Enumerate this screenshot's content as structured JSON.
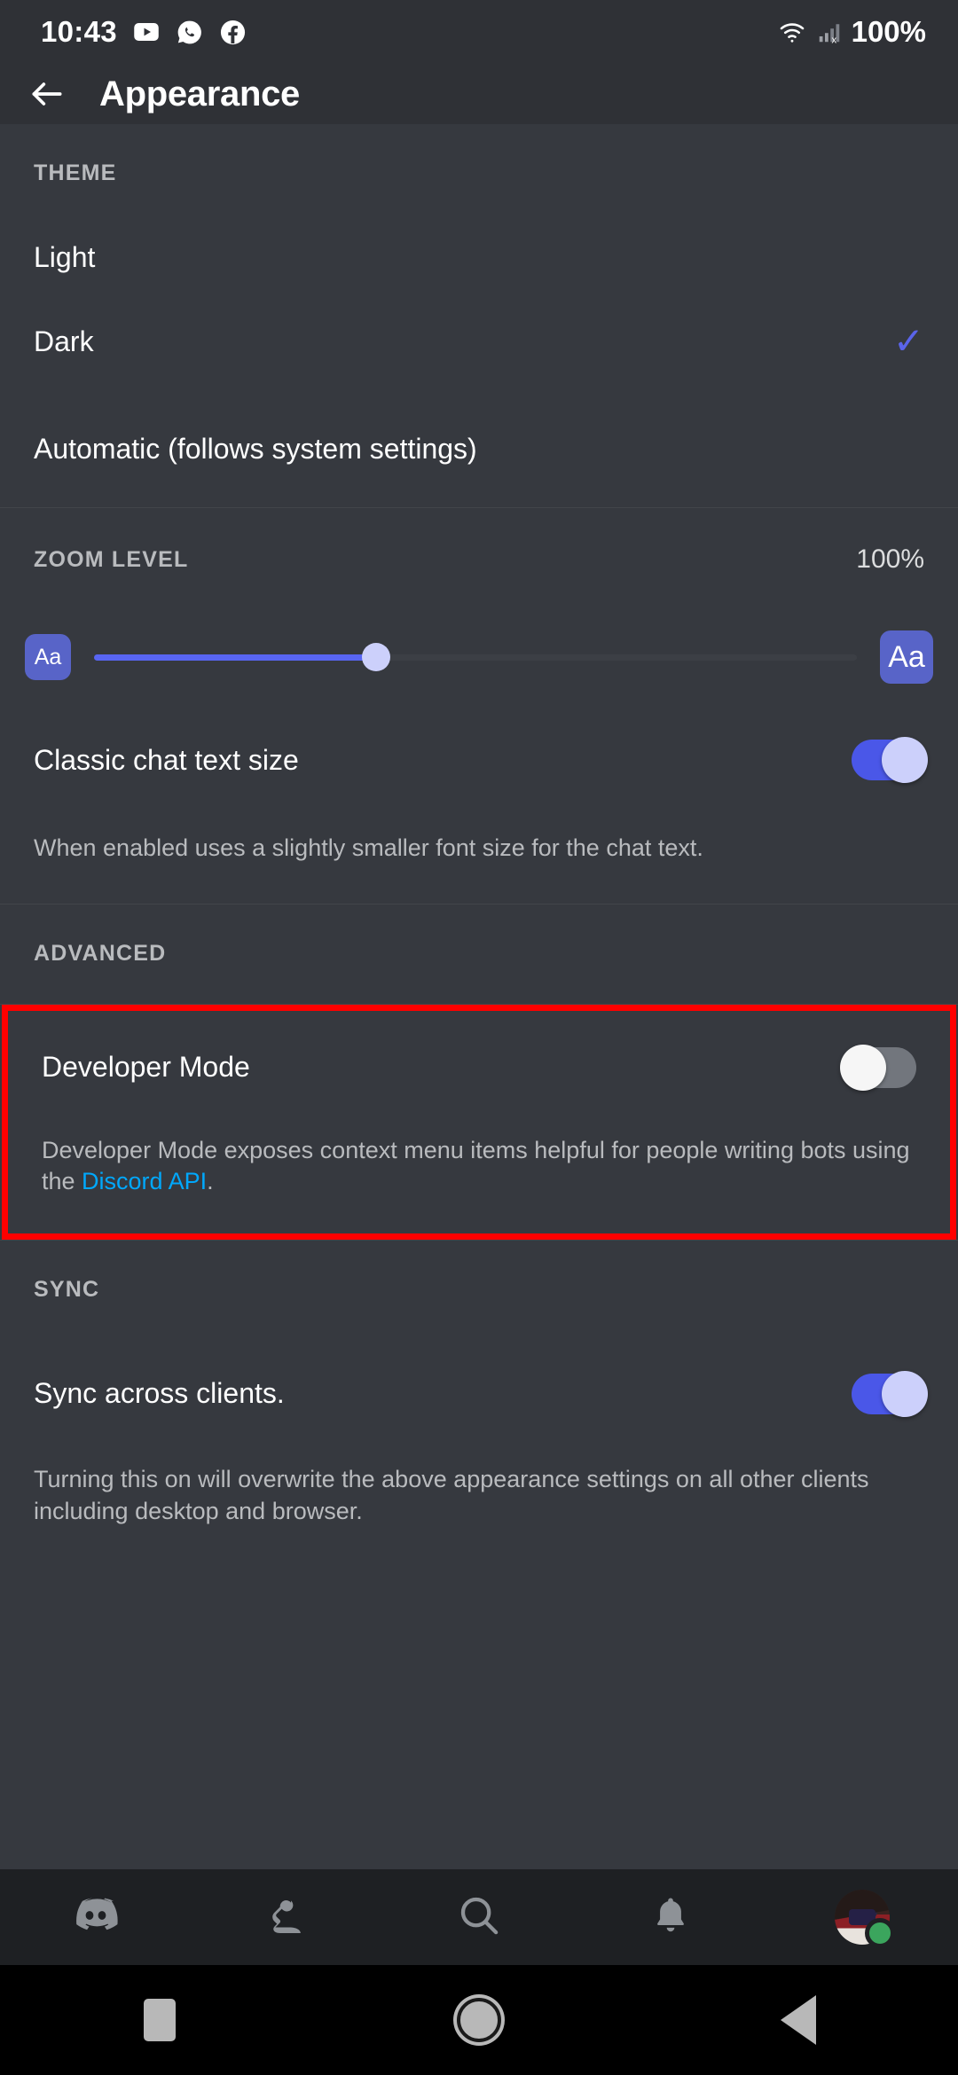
{
  "statusbar": {
    "time": "10:43",
    "battery": "100%",
    "icons": [
      "youtube-icon",
      "whatsapp-icon",
      "facebook-icon"
    ],
    "right_icons": [
      "wifi-icon",
      "cellular-signal-off-icon"
    ]
  },
  "header": {
    "back_label": "←",
    "title": "Appearance"
  },
  "theme": {
    "section_label": "THEME",
    "options": [
      {
        "label": "Light",
        "selected": false
      },
      {
        "label": "Dark",
        "selected": true
      },
      {
        "label": "Automatic (follows system settings)",
        "selected": false
      }
    ],
    "check_glyph": "✓",
    "accent": "#5a64ea"
  },
  "zoom": {
    "section_label": "ZOOM LEVEL",
    "value": "100%",
    "slider_percent": 37,
    "small_label": "Aa",
    "large_label": "Aa",
    "fill_color": "#5865f2",
    "button_color": "#5864c8"
  },
  "classic_text": {
    "label": "Classic chat text size",
    "enabled": true,
    "description": "When enabled uses a slightly smaller font size for the chat text."
  },
  "advanced": {
    "section_label": "ADVANCED",
    "developer_mode": {
      "label": "Developer Mode",
      "enabled": false,
      "description_before": "Developer Mode exposes context menu items helpful for people writing bots using the ",
      "link_text": "Discord API",
      "description_after": ".",
      "link_color": "#00a8fc",
      "highlight_color": "#ff0000"
    }
  },
  "sync": {
    "section_label": "SYNC",
    "label": "Sync across clients.",
    "enabled": true,
    "description": "Turning this on will overwrite the above appearance settings on all other clients including desktop and browser."
  },
  "bottomnav": {
    "items": [
      {
        "name": "discord-home-icon"
      },
      {
        "name": "friends-icon"
      },
      {
        "name": "search-icon"
      },
      {
        "name": "notifications-bell-icon"
      },
      {
        "name": "user-avatar"
      }
    ],
    "presence": "online"
  },
  "androidnav": {
    "items": [
      "recents-square-button",
      "home-circle-button",
      "back-triangle-button"
    ]
  }
}
